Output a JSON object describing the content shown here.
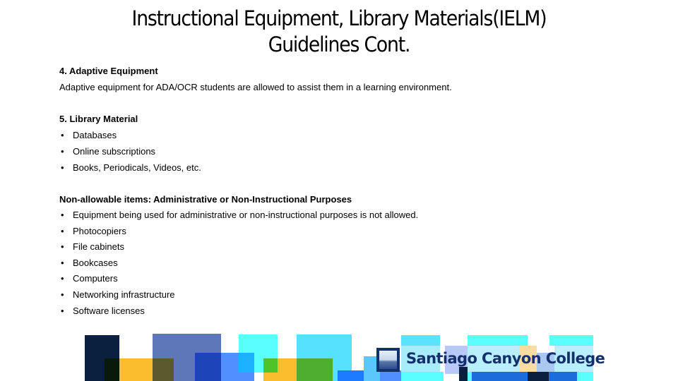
{
  "title": {
    "line1": "Instructional Equipment, Library Materials(IELM)",
    "line2": "Guidelines Cont."
  },
  "sections": [
    {
      "heading": "4. Adaptive Equipment",
      "text": "Adaptive equipment for ADA/OCR students are allowed to assist them in a learning environment."
    },
    {
      "heading": "5. Library Material",
      "bullets": [
        "Databases",
        "Online subscriptions",
        "Books, Periodicals, Videos, etc."
      ]
    },
    {
      "heading": "Non-allowable items: Administrative or Non-Instructional Purposes",
      "bullets": [
        "Equipment being used for administrative or non-instructional purposes is not allowed.",
        "Photocopiers",
        "File cabinets",
        "Bookcases",
        "Computers",
        "Networking infrastructure",
        "Software licenses"
      ]
    }
  ],
  "bullet_glyph": "•",
  "footer": {
    "logo_text": "Santiago Canyon College",
    "logo_icon": "college-landscape-emblem-icon",
    "brand_color": "#13306c"
  }
}
